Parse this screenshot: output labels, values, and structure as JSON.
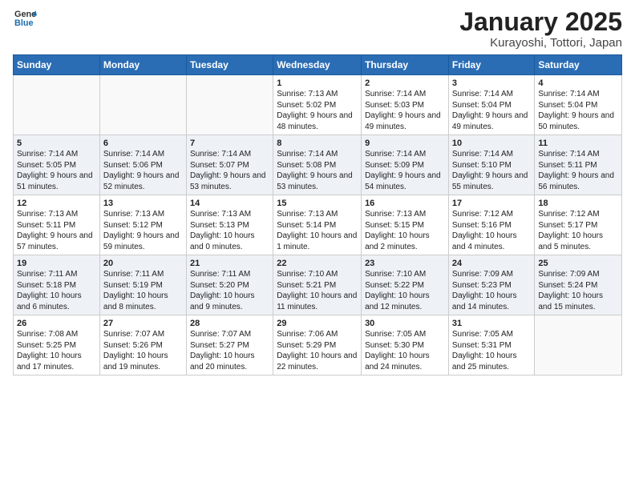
{
  "header": {
    "logo_general": "General",
    "logo_blue": "Blue",
    "month": "January 2025",
    "location": "Kurayoshi, Tottori, Japan"
  },
  "weekdays": [
    "Sunday",
    "Monday",
    "Tuesday",
    "Wednesday",
    "Thursday",
    "Friday",
    "Saturday"
  ],
  "weeks": [
    [
      {
        "day": "",
        "info": ""
      },
      {
        "day": "",
        "info": ""
      },
      {
        "day": "",
        "info": ""
      },
      {
        "day": "1",
        "info": "Sunrise: 7:13 AM\nSunset: 5:02 PM\nDaylight: 9 hours and 48 minutes."
      },
      {
        "day": "2",
        "info": "Sunrise: 7:14 AM\nSunset: 5:03 PM\nDaylight: 9 hours and 49 minutes."
      },
      {
        "day": "3",
        "info": "Sunrise: 7:14 AM\nSunset: 5:04 PM\nDaylight: 9 hours and 49 minutes."
      },
      {
        "day": "4",
        "info": "Sunrise: 7:14 AM\nSunset: 5:04 PM\nDaylight: 9 hours and 50 minutes."
      }
    ],
    [
      {
        "day": "5",
        "info": "Sunrise: 7:14 AM\nSunset: 5:05 PM\nDaylight: 9 hours and 51 minutes."
      },
      {
        "day": "6",
        "info": "Sunrise: 7:14 AM\nSunset: 5:06 PM\nDaylight: 9 hours and 52 minutes."
      },
      {
        "day": "7",
        "info": "Sunrise: 7:14 AM\nSunset: 5:07 PM\nDaylight: 9 hours and 53 minutes."
      },
      {
        "day": "8",
        "info": "Sunrise: 7:14 AM\nSunset: 5:08 PM\nDaylight: 9 hours and 53 minutes."
      },
      {
        "day": "9",
        "info": "Sunrise: 7:14 AM\nSunset: 5:09 PM\nDaylight: 9 hours and 54 minutes."
      },
      {
        "day": "10",
        "info": "Sunrise: 7:14 AM\nSunset: 5:10 PM\nDaylight: 9 hours and 55 minutes."
      },
      {
        "day": "11",
        "info": "Sunrise: 7:14 AM\nSunset: 5:11 PM\nDaylight: 9 hours and 56 minutes."
      }
    ],
    [
      {
        "day": "12",
        "info": "Sunrise: 7:13 AM\nSunset: 5:11 PM\nDaylight: 9 hours and 57 minutes."
      },
      {
        "day": "13",
        "info": "Sunrise: 7:13 AM\nSunset: 5:12 PM\nDaylight: 9 hours and 59 minutes."
      },
      {
        "day": "14",
        "info": "Sunrise: 7:13 AM\nSunset: 5:13 PM\nDaylight: 10 hours and 0 minutes."
      },
      {
        "day": "15",
        "info": "Sunrise: 7:13 AM\nSunset: 5:14 PM\nDaylight: 10 hours and 1 minute."
      },
      {
        "day": "16",
        "info": "Sunrise: 7:13 AM\nSunset: 5:15 PM\nDaylight: 10 hours and 2 minutes."
      },
      {
        "day": "17",
        "info": "Sunrise: 7:12 AM\nSunset: 5:16 PM\nDaylight: 10 hours and 4 minutes."
      },
      {
        "day": "18",
        "info": "Sunrise: 7:12 AM\nSunset: 5:17 PM\nDaylight: 10 hours and 5 minutes."
      }
    ],
    [
      {
        "day": "19",
        "info": "Sunrise: 7:11 AM\nSunset: 5:18 PM\nDaylight: 10 hours and 6 minutes."
      },
      {
        "day": "20",
        "info": "Sunrise: 7:11 AM\nSunset: 5:19 PM\nDaylight: 10 hours and 8 minutes."
      },
      {
        "day": "21",
        "info": "Sunrise: 7:11 AM\nSunset: 5:20 PM\nDaylight: 10 hours and 9 minutes."
      },
      {
        "day": "22",
        "info": "Sunrise: 7:10 AM\nSunset: 5:21 PM\nDaylight: 10 hours and 11 minutes."
      },
      {
        "day": "23",
        "info": "Sunrise: 7:10 AM\nSunset: 5:22 PM\nDaylight: 10 hours and 12 minutes."
      },
      {
        "day": "24",
        "info": "Sunrise: 7:09 AM\nSunset: 5:23 PM\nDaylight: 10 hours and 14 minutes."
      },
      {
        "day": "25",
        "info": "Sunrise: 7:09 AM\nSunset: 5:24 PM\nDaylight: 10 hours and 15 minutes."
      }
    ],
    [
      {
        "day": "26",
        "info": "Sunrise: 7:08 AM\nSunset: 5:25 PM\nDaylight: 10 hours and 17 minutes."
      },
      {
        "day": "27",
        "info": "Sunrise: 7:07 AM\nSunset: 5:26 PM\nDaylight: 10 hours and 19 minutes."
      },
      {
        "day": "28",
        "info": "Sunrise: 7:07 AM\nSunset: 5:27 PM\nDaylight: 10 hours and 20 minutes."
      },
      {
        "day": "29",
        "info": "Sunrise: 7:06 AM\nSunset: 5:29 PM\nDaylight: 10 hours and 22 minutes."
      },
      {
        "day": "30",
        "info": "Sunrise: 7:05 AM\nSunset: 5:30 PM\nDaylight: 10 hours and 24 minutes."
      },
      {
        "day": "31",
        "info": "Sunrise: 7:05 AM\nSunset: 5:31 PM\nDaylight: 10 hours and 25 minutes."
      },
      {
        "day": "",
        "info": ""
      }
    ]
  ]
}
